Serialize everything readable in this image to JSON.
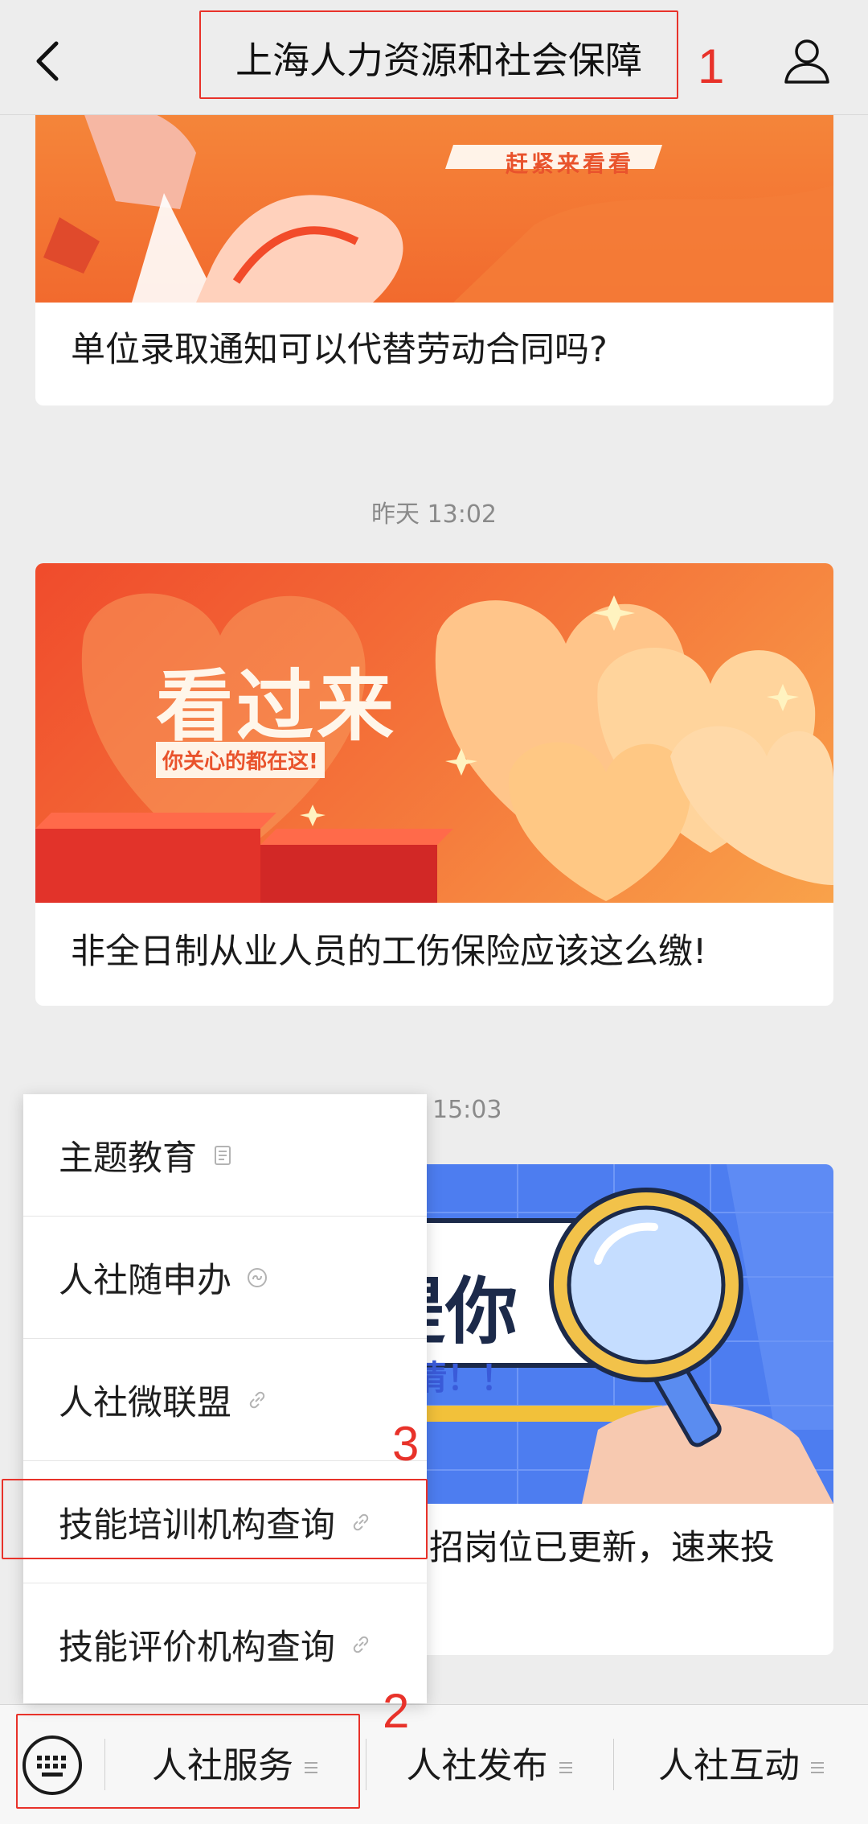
{
  "header": {
    "title": "上海人力资源和社会保障",
    "back_icon": "chevron-left-icon",
    "profile_icon": "person-icon"
  },
  "annotations": [
    "1",
    "2",
    "3"
  ],
  "feed": [
    {
      "banner_text": "赶紧来看看",
      "caption": "单位录取通知可以代替劳动合同吗?"
    },
    {
      "timestamp": "昨天 13:02",
      "banner_title": "看过来",
      "banner_sub": "你关心的都在这!",
      "caption": "非全日制从业人员的工伤保险应该这么缴!"
    },
    {
      "timestamp": "15:03",
      "banner_title": "提你",
      "banner_sub": "情！！",
      "caption": "招岗位已更新，速来投"
    }
  ],
  "menu": {
    "items": [
      {
        "label": "主题教育",
        "icon": "article-icon"
      },
      {
        "label": "人社随申办",
        "icon": "miniprogram-icon"
      },
      {
        "label": "人社微联盟",
        "icon": "link-icon"
      },
      {
        "label": "技能培训机构查询",
        "icon": "link-icon"
      },
      {
        "label": "技能评价机构查询",
        "icon": "link-icon"
      }
    ]
  },
  "bottom_bar": {
    "keyboard_icon": "keyboard-icon",
    "tabs": [
      {
        "label": "人社服务"
      },
      {
        "label": "人社发布"
      },
      {
        "label": "人社互动"
      }
    ]
  },
  "colors": {
    "annotation": "#e8322a",
    "banner_orange": "#f36b34"
  }
}
